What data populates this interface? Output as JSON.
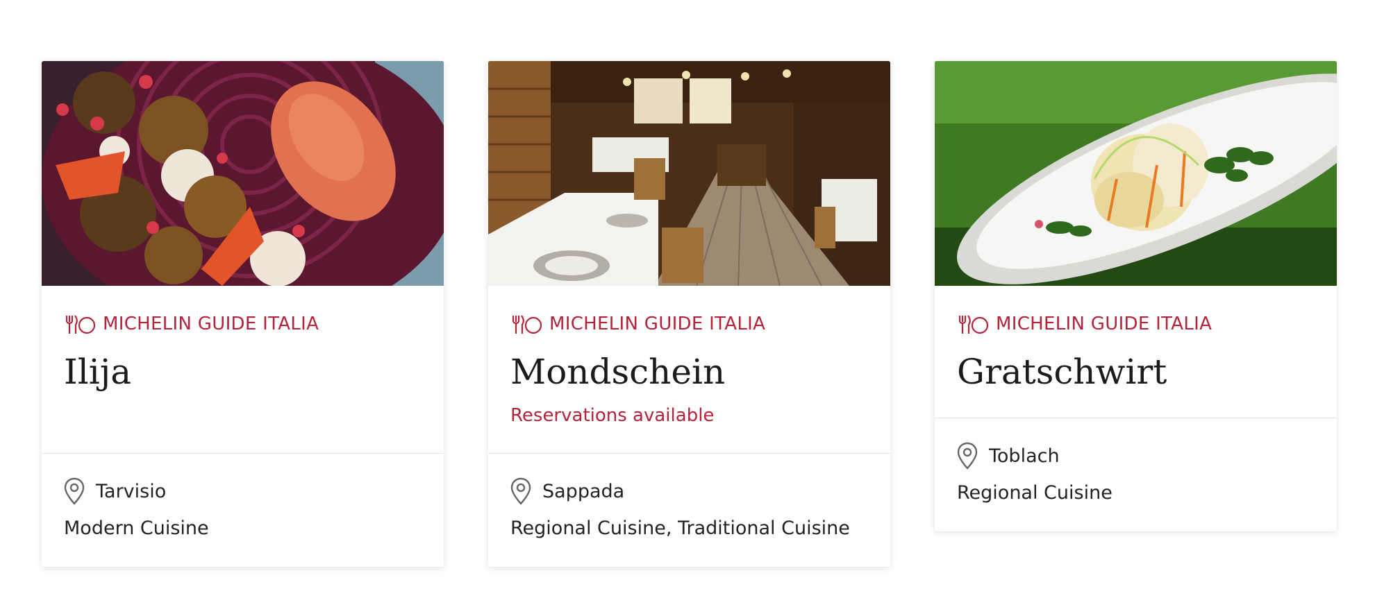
{
  "cards": [
    {
      "guide": "MICHELIN GUIDE ITALIA",
      "name": "Ilija",
      "reservation": "",
      "location": "Tarvisio",
      "cuisine": "Modern Cuisine"
    },
    {
      "guide": "MICHELIN GUIDE ITALIA",
      "name": "Mondschein",
      "reservation": "Reservations available",
      "location": "Sappada",
      "cuisine": "Regional Cuisine, Traditional Cuisine"
    },
    {
      "guide": "MICHELIN GUIDE ITALIA",
      "name": "Gratschwirt",
      "reservation": "",
      "location": "Toblach",
      "cuisine": "Regional Cuisine"
    }
  ],
  "icons": {
    "guide": "fork-knife-plate-icon",
    "location": "map-pin-icon"
  },
  "colors": {
    "accent": "#b5233a",
    "text": "#222222"
  }
}
